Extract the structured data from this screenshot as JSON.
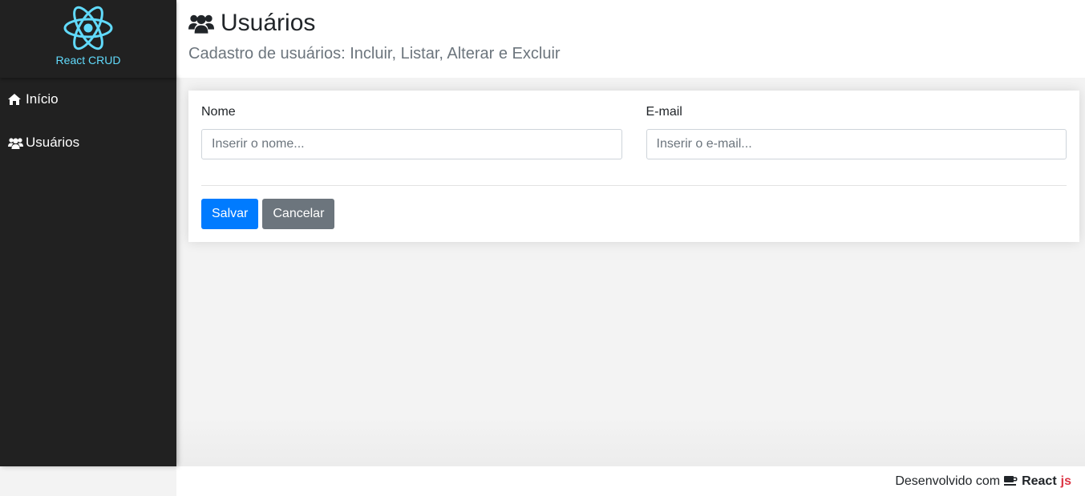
{
  "brand": {
    "name": "React CRUD",
    "logo_icon": "react-logo-icon",
    "color": "#61dafb"
  },
  "sidebar": {
    "items": [
      {
        "label": "Início",
        "icon": "home-icon"
      },
      {
        "label": "Usuários",
        "icon": "users-icon"
      }
    ]
  },
  "header": {
    "title": "Usuários",
    "title_icon": "users-icon",
    "subtitle": "Cadastro de usuários: Incluir, Listar, Alterar e Excluir"
  },
  "form": {
    "name_label": "Nome",
    "name_placeholder": "Inserir o nome...",
    "name_value": "",
    "email_label": "E-mail",
    "email_placeholder": "Inserir o e-mail...",
    "email_value": "",
    "save_label": "Salvar",
    "cancel_label": "Cancelar"
  },
  "footer": {
    "prefix": "Desenvolvido com",
    "icon": "coffee-icon",
    "react": "React",
    "js": "js"
  },
  "colors": {
    "sidebar_bg": "#212121",
    "primary": "#007bff",
    "secondary": "#6c757d",
    "js_accent": "#dc3545"
  }
}
